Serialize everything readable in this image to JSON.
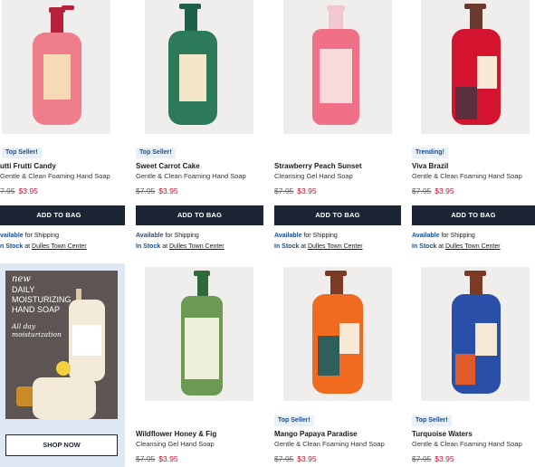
{
  "products": [
    {
      "badge": "Top Seller!",
      "name": "utti Frutti Candy",
      "desc": "Gentle & Clean Foaming Hand Soap",
      "old_price": "7.95",
      "new_price": "$3.95",
      "button": "ADD TO BAG",
      "avail": "vailable",
      "ship": "for Shipping",
      "stock": "n Stock",
      "at": "at",
      "store": "Dulles Town Center",
      "bottle_color": "#ee7e8c",
      "pump_color": "#b5213a"
    },
    {
      "badge": "Top Seller!",
      "name": "Sweet Carrot Cake",
      "desc": "Gentle & Clean Foaming Hand Soap",
      "old_price": "$7.95",
      "new_price": "$3.95",
      "button": "ADD TO BAG",
      "avail": "Available",
      "ship": "for Shipping",
      "stock": "In Stock",
      "at": "at",
      "store": "Dulles Town Center",
      "bottle_color": "#2c7a5a",
      "pump_color": "#1e6048"
    },
    {
      "badge": "",
      "name": "Strawberry Peach Sunset",
      "desc": "Cleansing Gel Hand Soap",
      "old_price": "$7.95",
      "new_price": "$3.95",
      "button": "ADD TO BAG",
      "avail": "Available",
      "ship": "for Shipping",
      "stock": "In Stock",
      "at": "at",
      "store": "Dulles Town Center",
      "bottle_color": "#ef6f86",
      "pump_color": "#f2c8cf"
    },
    {
      "badge": "Trending!",
      "name": "Viva Brazil",
      "desc": "Gentle & Clean Foaming Hand Soap",
      "old_price": "$7.95",
      "new_price": "$3.95",
      "button": "ADD TO BAG",
      "avail": "Available",
      "ship": "for Shipping",
      "stock": "In Stock",
      "at": "at",
      "store": "Dulles Town Center",
      "bottle_color": "#d4142f",
      "pump_color": "#6b3a2c"
    },
    {
      "badge": "",
      "name": "Wildflower Honey & Fig",
      "desc": "Cleansing Gel Hand Soap",
      "old_price": "$7.95",
      "new_price": "$3.95",
      "bottle_color": "#6c9a52",
      "pump_color": "#2e6a3a"
    },
    {
      "badge": "Top Seller!",
      "name": "Mango Papaya Paradise",
      "desc": "Gentle & Clean Foaming Hand Soap",
      "old_price": "$7.95",
      "new_price": "$3.95",
      "bottle_color": "#f06a20",
      "pump_color": "#7a3a24"
    },
    {
      "badge": "Top Seller!",
      "name": "Turquoise Waters",
      "desc": "Gentle & Clean Foaming Hand Soap",
      "old_price": "$7.95",
      "new_price": "$3.95",
      "bottle_color": "#2a4fa8",
      "pump_color": "#7a3a24"
    }
  ],
  "promo": {
    "new": "new",
    "title": "DAILY MOISTURIZING HAND SOAP",
    "sub": "All day moisturization",
    "button": "SHOP NOW"
  },
  "colors": {
    "button_bg": "#1b2533",
    "sale_price": "#c8102e",
    "link_blue": "#1a4d8c"
  }
}
